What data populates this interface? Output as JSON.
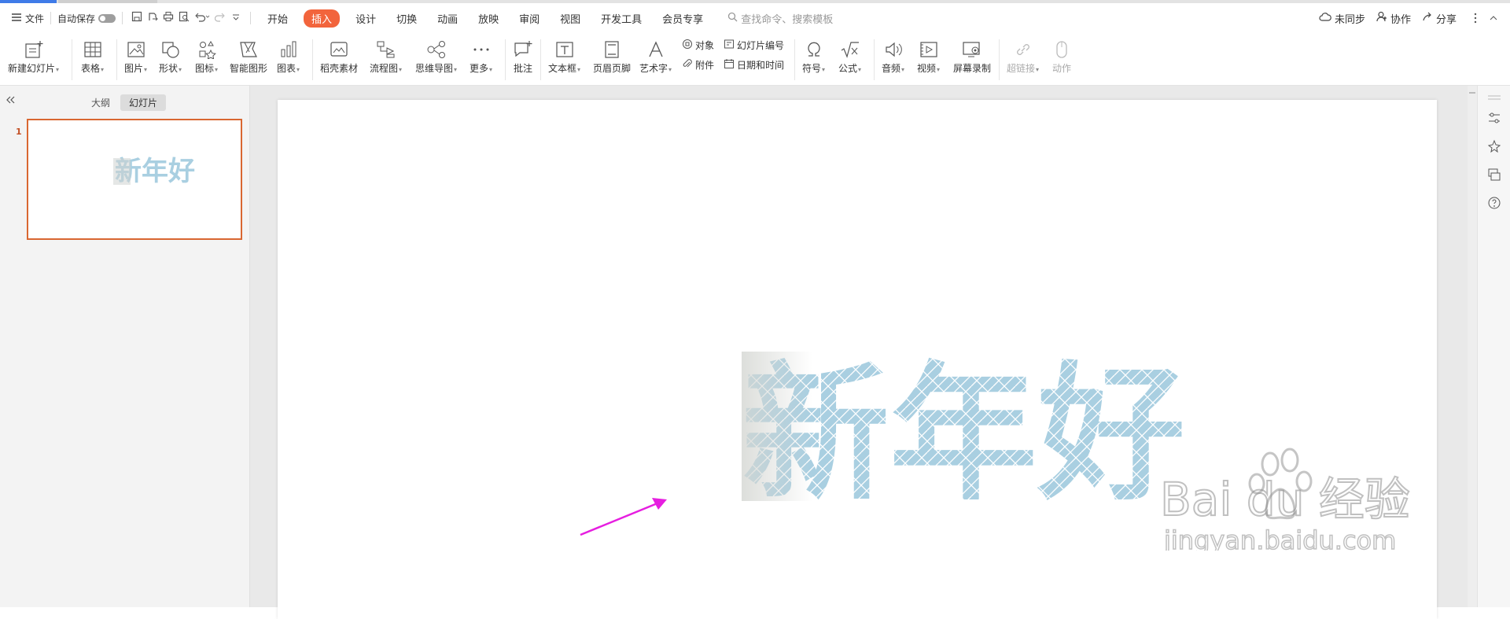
{
  "menubar": {
    "file_label": "文件",
    "autosave_label": "自动保存",
    "tabs": [
      "开始",
      "插入",
      "设计",
      "切换",
      "动画",
      "放映",
      "审阅",
      "视图",
      "开发工具",
      "会员专享"
    ],
    "active_tab": "插入",
    "search_placeholder": "查找命令、搜索模板",
    "sync_label": "未同步",
    "collab_label": "协作",
    "share_label": "分享"
  },
  "ribbon": {
    "new_slide": "新建幻灯片",
    "table": "表格",
    "picture": "图片",
    "shape": "形状",
    "icon": "图标",
    "smart_shape": "智能图形",
    "chart": "图表",
    "material": "稻壳素材",
    "flowchart": "流程图",
    "mindmap": "思维导图",
    "more": "更多",
    "comment": "批注",
    "textbox": "文本框",
    "header_footer": "页眉页脚",
    "wordart": "艺术字",
    "object": "对象",
    "attachment": "附件",
    "slide_number": "幻灯片编号",
    "datetime": "日期和时间",
    "symbol": "符号",
    "formula": "公式",
    "audio": "音频",
    "video": "视频",
    "screen_record": "屏幕录制",
    "hyperlink": "超链接",
    "action": "动作"
  },
  "leftpanel": {
    "outline_tab": "大纲",
    "slides_tab": "幻灯片",
    "slide_number": "1",
    "thumb_text": "新年好"
  },
  "slide": {
    "title_text": "新年好"
  },
  "watermark": {
    "logo": "Bai du 经验",
    "url": "jingyan.baidu.com"
  },
  "colors": {
    "accent": "#f2643c",
    "thumb_border": "#d96731",
    "text_fill": "#a9cfe1",
    "arrow": "#e61ee0"
  }
}
